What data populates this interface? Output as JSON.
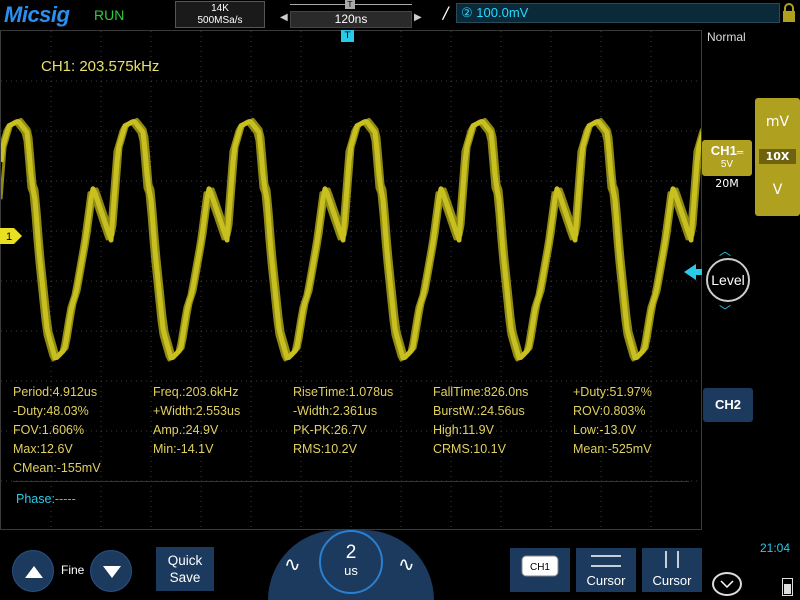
{
  "header": {
    "brand": "Micsig",
    "run_state": "RUN",
    "memory_depth": "14K",
    "sample_rate": "500MSa/s",
    "trigger_position": "120ns",
    "trigger_marker": "T",
    "trigger_source": "②",
    "trigger_level": "100.0mV"
  },
  "plot": {
    "frequency_readout": "CH1: 203.575kHz",
    "channel_marker": "1",
    "trigger_top_marker": "T",
    "measurements": [
      [
        "Period:4.912us",
        "Freq.:203.6kHz",
        "RiseTime:1.078us",
        "FallTime:826.0ns",
        "+Duty:51.97%"
      ],
      [
        "-Duty:48.03%",
        "+Width:2.553us",
        "-Width:2.361us",
        "BurstW.:24.56us",
        "ROV:0.803%"
      ],
      [
        "FOV:1.606%",
        "Amp.:24.9V",
        "PK-PK:26.7V",
        "High:11.9V",
        "Low:-13.0V"
      ],
      [
        "Max:12.6V",
        "Min:-14.1V",
        "RMS:10.2V",
        "CRMS:10.1V",
        "Mean:-525mV"
      ],
      [
        "CMean:-155mV",
        "",
        "",
        "",
        ""
      ]
    ],
    "phase": "Phase:-----"
  },
  "right_panel": {
    "mode": "Normal",
    "unit_mv": "mV",
    "probe_x": "10X",
    "unit_v": "V",
    "ch1_label": "CH1",
    "ch1_scale": "5V",
    "ch1_bandwidth": "20M",
    "level_label": "Level",
    "ch2_label": "CH2"
  },
  "bottom": {
    "fine_label": "Fine",
    "quick_save_line1": "Quick",
    "quick_save_line2": "Save",
    "timebase_value": "2",
    "timebase_unit": "us",
    "ch1_mini": "CH1",
    "cursor1_label": "Cursor",
    "cursor2_label": "Cursor",
    "time": "21:04"
  },
  "colors": {
    "trace": "#c8c020",
    "accent_blue": "#1c3a5e",
    "cyan": "#29c9e8",
    "ch1_yellow": "#b0a020"
  }
}
